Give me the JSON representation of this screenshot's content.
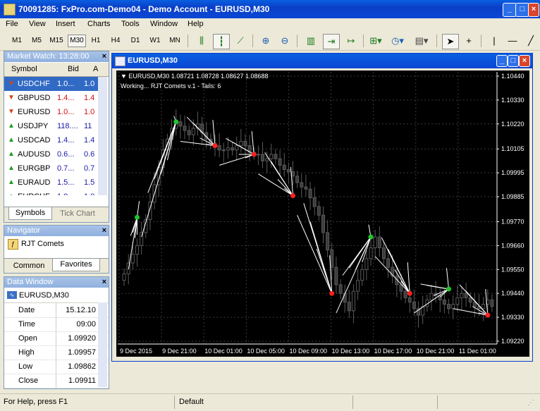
{
  "window": {
    "title": "70091285: FxPro.com-Demo04 - Demo Account - EURUSD,M30"
  },
  "menu": [
    "File",
    "View",
    "Insert",
    "Charts",
    "Tools",
    "Window",
    "Help"
  ],
  "timeframes": [
    "M1",
    "M5",
    "M15",
    "M30",
    "H1",
    "H4",
    "D1",
    "W1",
    "MN"
  ],
  "active_timeframe": "M30",
  "market_watch": {
    "title": "Market Watch: 13:28:00",
    "columns": {
      "symbol": "Symbol",
      "bid": "Bid",
      "ask": "A"
    },
    "rows": [
      {
        "symbol": "USDCHF",
        "bid": "1.0...",
        "ask": "1.0",
        "dir": "down",
        "selected": true
      },
      {
        "symbol": "GBPUSD",
        "bid": "1.4...",
        "ask": "1.4",
        "dir": "down"
      },
      {
        "symbol": "EURUSD",
        "bid": "1.0...",
        "ask": "1.0",
        "dir": "down"
      },
      {
        "symbol": "USDJPY",
        "bid": "118....",
        "ask": "11",
        "dir": "up"
      },
      {
        "symbol": "USDCAD",
        "bid": "1.4...",
        "ask": "1.4",
        "dir": "up"
      },
      {
        "symbol": "AUDUSD",
        "bid": "0.6...",
        "ask": "0.6",
        "dir": "up"
      },
      {
        "symbol": "EURGBP",
        "bid": "0.7...",
        "ask": "0.7",
        "dir": "up"
      },
      {
        "symbol": "EURAUD",
        "bid": "1.5...",
        "ask": "1.5",
        "dir": "up"
      },
      {
        "symbol": "EURCHF",
        "bid": "1.0...",
        "ask": "1.0",
        "dir": "up"
      }
    ],
    "tabs": [
      "Symbols",
      "Tick Chart"
    ]
  },
  "navigator": {
    "title": "Navigator",
    "item": "RJT Comets",
    "tabs": [
      "Common",
      "Favorites"
    ]
  },
  "data_window": {
    "title": "Data Window",
    "symbol": "EURUSD,M30",
    "rows": [
      {
        "k": "Date",
        "v": "15.12.10"
      },
      {
        "k": "Time",
        "v": "09:00"
      },
      {
        "k": "Open",
        "v": "1.09920"
      },
      {
        "k": "High",
        "v": "1.09957"
      },
      {
        "k": "Low",
        "v": "1.09862"
      },
      {
        "k": "Close",
        "v": "1.09911"
      }
    ]
  },
  "chart": {
    "window_title": "EURUSD,M30",
    "info_line": "▼ EURUSD,M30  1.08721 1.08728 1.08627 1.08688",
    "indicator_line": "Working... RJT Comets v.1 - Tails: 6"
  },
  "chart_data": {
    "type": "candlestick",
    "price_labels": [
      "1.10440",
      "1.10330",
      "1.10220",
      "1.10105",
      "1.09995",
      "1.09885",
      "1.09770",
      "1.09660",
      "1.09550",
      "1.09440",
      "1.09330",
      "1.09220"
    ],
    "time_labels": [
      "9 Dec 2015",
      "9 Dec 21:00",
      "10 Dec 01:00",
      "10 Dec 05:00",
      "10 Dec 09:00",
      "10 Dec 13:00",
      "10 Dec 17:00",
      "10 Dec 21:00",
      "11 Dec 01:00"
    ],
    "ylim": [
      1.0922,
      1.1044
    ],
    "bar_count": 86,
    "close": [
      1.0953,
      1.0958,
      1.0962,
      1.0966,
      1.0972,
      1.0978,
      1.0986,
      1.0994,
      1.1002,
      1.101,
      1.1015,
      1.102,
      1.1023,
      1.1021,
      1.1019,
      1.1017,
      1.102,
      1.1022,
      1.1018,
      1.1015,
      1.1013,
      1.1012,
      1.101,
      1.101,
      1.1011,
      1.101,
      1.1012,
      1.1014,
      1.1012,
      1.1009,
      1.1008,
      1.1008,
      1.1005,
      1.1006,
      1.1008,
      1.1006,
      1.1003,
      1.1001,
      1.1,
      1.0998,
      1.0995,
      1.0993,
      1.0992,
      1.0988,
      1.0984,
      1.098,
      1.0972,
      1.0964,
      1.0956,
      1.0948,
      1.0944,
      1.094,
      1.0936,
      1.0945,
      1.095,
      1.0955,
      1.096,
      1.0965,
      1.097,
      1.0965,
      1.096,
      1.0956,
      1.0952,
      1.0948,
      1.0945,
      1.0942,
      1.094,
      1.0937,
      1.0934,
      1.0938,
      1.0941,
      1.0944,
      1.0943,
      1.0941,
      1.0939,
      1.0937,
      1.0939,
      1.0942,
      1.0944,
      1.0942,
      1.094,
      1.0938,
      1.0937,
      1.0939,
      1.0941,
      1.0938
    ],
    "comet_points": [
      {
        "bar": 3,
        "price": 1.0979,
        "color": "#22c42a"
      },
      {
        "bar": 12,
        "price": 1.1023,
        "color": "#22c42a"
      },
      {
        "bar": 21,
        "price": 1.1012,
        "color": "#ff2020"
      },
      {
        "bar": 30,
        "price": 1.1008,
        "color": "#ff2020"
      },
      {
        "bar": 39,
        "price": 1.0989,
        "color": "#ff2020"
      },
      {
        "bar": 48,
        "price": 1.0944,
        "color": "#ff2020"
      },
      {
        "bar": 57,
        "price": 1.097,
        "color": "#22c42a"
      },
      {
        "bar": 66,
        "price": 1.0944,
        "color": "#ff2020"
      },
      {
        "bar": 75,
        "price": 1.0946,
        "color": "#22c42a"
      },
      {
        "bar": 84,
        "price": 1.0934,
        "color": "#ff2020"
      }
    ]
  },
  "status": {
    "help": "For Help, press F1",
    "profile": "Default"
  }
}
